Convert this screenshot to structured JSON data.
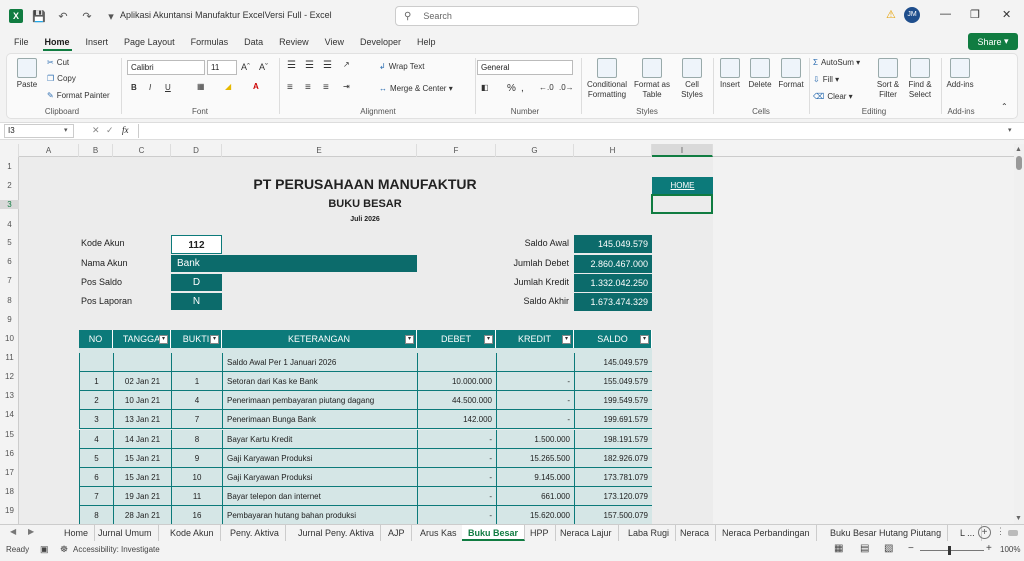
{
  "titlebar": {
    "app_icon": "X",
    "doc_title": "Aplikasi Akuntansi Manufaktur ExcelVersi Full  -  Excel",
    "search_placeholder": "Search",
    "user_initials": "JM"
  },
  "menu": {
    "tabs": [
      "File",
      "Home",
      "Insert",
      "Page Layout",
      "Formulas",
      "Data",
      "Review",
      "View",
      "Developer",
      "Help"
    ],
    "active": "Home",
    "share_label": "Share"
  },
  "ribbon": {
    "clipboard": {
      "paste": "Paste",
      "cut": "Cut",
      "copy": "Copy",
      "format_painter": "Format Painter",
      "label": "Clipboard"
    },
    "font": {
      "name": "Calibri",
      "size": "11",
      "label": "Font",
      "bold": "B",
      "italic": "I",
      "underline": "U"
    },
    "alignment": {
      "wrap": "Wrap Text",
      "merge": "Merge & Center",
      "label": "Alignment"
    },
    "number": {
      "format": "General",
      "label": "Number"
    },
    "styles": {
      "conditional": "Conditional Formatting",
      "table": "Format as Table",
      "cell_styles": "Cell Styles",
      "label": "Styles"
    },
    "cells": {
      "insert": "Insert",
      "delete": "Delete",
      "format": "Format",
      "label": "Cells"
    },
    "editing": {
      "autosum": "AutoSum",
      "fill": "Fill",
      "clear": "Clear",
      "sort": "Sort & Filter",
      "find": "Find & Select",
      "label": "Editing"
    },
    "addins": {
      "addins": "Add-ins",
      "label": "Add-ins"
    }
  },
  "formula_bar": {
    "name_box": "I3",
    "fx": "fx",
    "value": ""
  },
  "columns": [
    "A",
    "B",
    "C",
    "D",
    "E",
    "F",
    "G",
    "H",
    "I"
  ],
  "rows": [
    "1",
    "2",
    "3",
    "4",
    "5",
    "6",
    "7",
    "8",
    "9",
    "10",
    "11",
    "12",
    "13",
    "14",
    "15",
    "16",
    "17",
    "18",
    "19"
  ],
  "sheet": {
    "company": "PT PERUSAHAAN MANUFAKTUR",
    "report": "BUKU BESAR",
    "period": "Juli 2026",
    "home_link": "HOME",
    "info": [
      {
        "label": "Kode Akun",
        "value": "112"
      },
      {
        "label": "Nama Akun",
        "value": "Bank"
      },
      {
        "label": "Pos Saldo",
        "value": "D"
      },
      {
        "label": "Pos Laporan",
        "value": "N"
      }
    ],
    "summary": [
      {
        "label": "Saldo Awal",
        "value": "145.049.579"
      },
      {
        "label": "Jumlah Debet",
        "value": "2.860.467.000"
      },
      {
        "label": "Jumlah Kredit",
        "value": "1.332.042.250"
      },
      {
        "label": "Saldo Akhir",
        "value": "1.673.474.329"
      }
    ],
    "table_headers": [
      "NO",
      "TANGGA",
      "BUKTI",
      "KETERANGAN",
      "DEBET",
      "KREDIT",
      "SALDO"
    ],
    "opening_row": {
      "desc": "Saldo Awal Per 1 Januari 2026",
      "saldo": "145.049.579"
    },
    "rows": [
      {
        "no": "1",
        "tgl": "02 Jan 21",
        "bukti": "1",
        "ket": "Setoran dari Kas ke Bank",
        "debet": "10.000.000",
        "kredit": "-",
        "saldo": "155.049.579"
      },
      {
        "no": "2",
        "tgl": "10 Jan 21",
        "bukti": "4",
        "ket": "Penerimaan pembayaran piutang dagang",
        "debet": "44.500.000",
        "kredit": "-",
        "saldo": "199.549.579"
      },
      {
        "no": "3",
        "tgl": "13 Jan 21",
        "bukti": "7",
        "ket": "Penerimaan Bunga Bank",
        "debet": "142.000",
        "kredit": "-",
        "saldo": "199.691.579"
      },
      {
        "no": "4",
        "tgl": "14 Jan 21",
        "bukti": "8",
        "ket": "Bayar Kartu Kredit",
        "debet": "-",
        "kredit": "1.500.000",
        "saldo": "198.191.579"
      },
      {
        "no": "5",
        "tgl": "15 Jan 21",
        "bukti": "9",
        "ket": "Gaji Karyawan Produksi",
        "debet": "-",
        "kredit": "15.265.500",
        "saldo": "182.926.079"
      },
      {
        "no": "6",
        "tgl": "15 Jan 21",
        "bukti": "10",
        "ket": "Gaji Karyawan Produksi",
        "debet": "-",
        "kredit": "9.145.000",
        "saldo": "173.781.079"
      },
      {
        "no": "7",
        "tgl": "19 Jan 21",
        "bukti": "11",
        "ket": "Bayar telepon dan internet",
        "debet": "-",
        "kredit": "661.000",
        "saldo": "173.120.079"
      },
      {
        "no": "8",
        "tgl": "28 Jan 21",
        "bukti": "16",
        "ket": "Pembayaran hutang bahan produksi",
        "debet": "-",
        "kredit": "15.620.000",
        "saldo": "157.500.079"
      }
    ]
  },
  "sheet_tabs": [
    "Home",
    "Jurnal Umum",
    "Kode Akun",
    "Peny. Aktiva",
    "Jurnal Peny. Aktiva",
    "AJP",
    "Arus Kas",
    "Buku Besar",
    "HPP",
    "Neraca Lajur",
    "Laba Rugi",
    "Neraca",
    "Neraca Perbandingan",
    "Buku Besar Hutang Piutang",
    "L ..."
  ],
  "active_sheet": "Buku Besar",
  "status": {
    "ready": "Ready",
    "accessibility": "Accessibility: Investigate",
    "zoom": "100%"
  }
}
